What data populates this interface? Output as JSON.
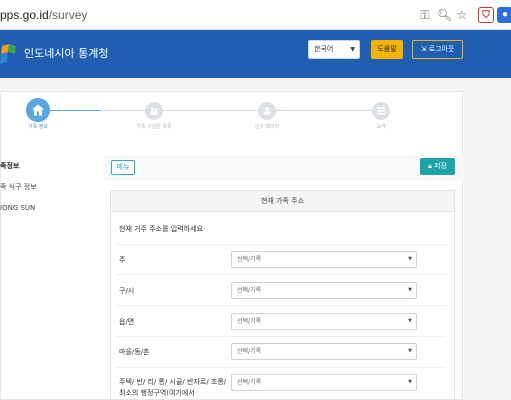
{
  "browser": {
    "url_main": "pps.go.id",
    "url_path": "/survey",
    "icons": [
      "key-icon",
      "zoom-icon",
      "star-icon",
      "extension-icon",
      "extension-icon-2"
    ]
  },
  "header": {
    "title": "인도네시아 통계청",
    "language_selected": "한국어",
    "help_label": "도움말",
    "logout_label": "로그아웃",
    "colors": {
      "header_bg": "#1f5eb1",
      "help_bg": "#f4b400"
    }
  },
  "stepper": {
    "steps": [
      {
        "label": "가족 정보",
        "active": true
      },
      {
        "label": "가족 구성원 목록",
        "active": false
      },
      {
        "label": "인구 데이터",
        "active": false
      },
      {
        "label": "요약",
        "active": false
      }
    ]
  },
  "sidebar": {
    "items": [
      {
        "label": "족정보",
        "active": true
      },
      {
        "label": "족 식구 정보",
        "active": false
      },
      {
        "label": "IONG SUN",
        "active": false
      }
    ]
  },
  "toolbar": {
    "menu_label": "메뉴",
    "save_label": "저장"
  },
  "form": {
    "section_title": "현재 가족 주소",
    "instruction": "현재 거주 주소를 입력하세요",
    "placeholder": "선택/기록",
    "fields": [
      {
        "label": "주"
      },
      {
        "label": "구/시"
      },
      {
        "label": "읍/면"
      },
      {
        "label": "마을/동/촌"
      },
      {
        "label": "주택/ 반/ 리/ 통/ 시골/ 반자르/ 조롱/ 최소의 행정구역(여기에서"
      }
    ]
  }
}
